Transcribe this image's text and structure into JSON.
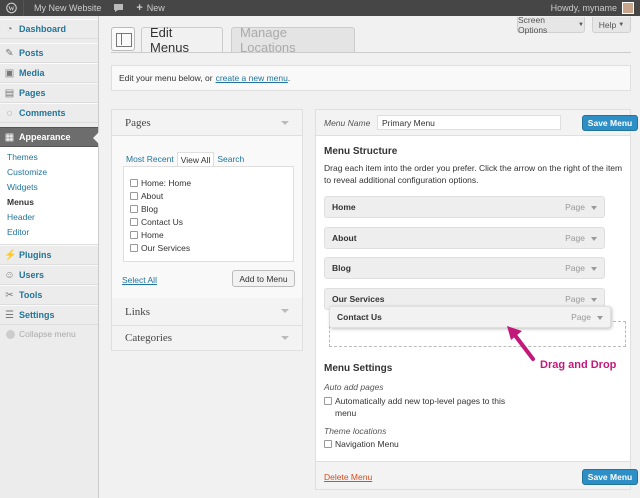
{
  "admin_bar": {
    "site_name": "My New Website",
    "new_label": "New",
    "howdy": "Howdy, myname"
  },
  "sidebar": {
    "items_top": [
      {
        "label": "Dashboard",
        "icon": "dashboard-icon"
      },
      {
        "label": "Posts",
        "icon": "pin-icon"
      },
      {
        "label": "Media",
        "icon": "media-icon"
      },
      {
        "label": "Pages",
        "icon": "page-icon"
      },
      {
        "label": "Comments",
        "icon": "comment-icon"
      }
    ],
    "appearance": {
      "label": "Appearance",
      "icon": "appearance-icon"
    },
    "submenu": [
      "Themes",
      "Customize",
      "Widgets",
      "Menus",
      "Header",
      "Editor"
    ],
    "items_bottom": [
      {
        "label": "Plugins",
        "icon": "plugin-icon"
      },
      {
        "label": "Users",
        "icon": "users-icon"
      },
      {
        "label": "Tools",
        "icon": "tools-icon"
      },
      {
        "label": "Settings",
        "icon": "settings-icon"
      }
    ],
    "collapse": "Collapse menu"
  },
  "top_buttons": {
    "screen_options": "Screen Options",
    "help": "Help"
  },
  "tabs": {
    "edit": "Edit Menus",
    "manage": "Manage Locations"
  },
  "intro": {
    "text": "Edit your menu below, or ",
    "link": "create a new menu",
    "end": "."
  },
  "pages_box": {
    "title": "Pages",
    "tabs": [
      "Most Recent",
      "View All",
      "Search"
    ],
    "items": [
      "Home: Home",
      "About",
      "Blog",
      "Contact Us",
      "Home",
      "Our Services"
    ],
    "select_all": "Select All",
    "add_button": "Add to Menu"
  },
  "links_box": {
    "title": "Links"
  },
  "categories_box": {
    "title": "Categories"
  },
  "menu": {
    "name_label": "Menu Name",
    "name_value": "Primary Menu",
    "save_label": "Save Menu",
    "structure_title": "Menu Structure",
    "structure_desc": "Drag each item into the order you prefer. Click the arrow on the right of the item to reveal additional configuration options.",
    "items": [
      {
        "label": "Home",
        "type": "Page"
      },
      {
        "label": "About",
        "type": "Page"
      },
      {
        "label": "Blog",
        "type": "Page"
      },
      {
        "label": "Our Services",
        "type": "Page"
      }
    ],
    "dragging_item": {
      "label": "Contact Us",
      "type": "Page"
    },
    "drag_annotation": "Drag and Drop",
    "settings_title": "Menu Settings",
    "auto_add_label": "Auto add pages",
    "auto_add_text": "Automatically add new top-level pages to this menu",
    "locations_label": "Theme locations",
    "navigation_menu": "Navigation Menu",
    "delete_label": "Delete Menu"
  },
  "colors": {
    "accent": "#2e8fc6",
    "link": "#21759b",
    "annotation": "#c2187a",
    "delete": "#d54e21"
  }
}
